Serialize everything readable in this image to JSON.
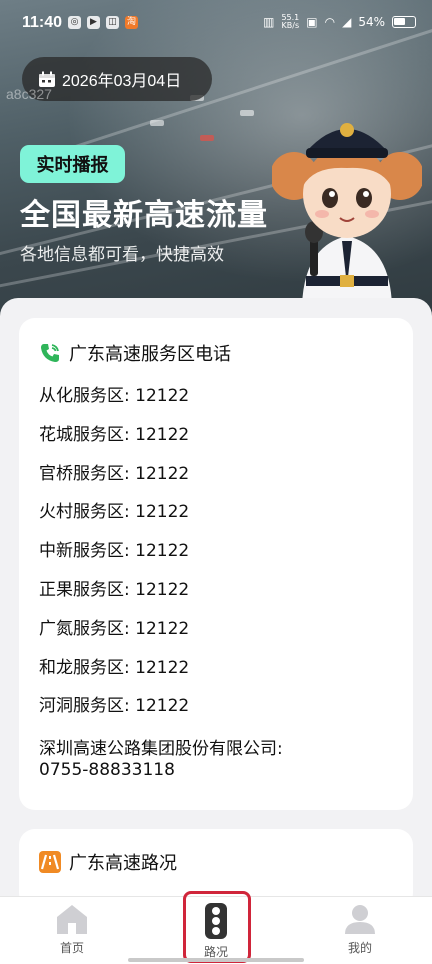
{
  "status_bar": {
    "time": "11:40",
    "net_speed_top": "55.1",
    "net_speed_bottom": "KB/s",
    "battery": "54%"
  },
  "hero": {
    "date": "2026年03月04日",
    "watermark": "a8c327",
    "badge": "实时播报",
    "title": "全国最新高速流量",
    "subtitle": "各地信息都可看，快捷高效"
  },
  "service_card": {
    "title": "广东高速服务区电话",
    "items": [
      "从化服务区: 12122",
      "花城服务区: 12122",
      "官桥服务区: 12122",
      "火村服务区: 12122",
      "中新服务区: 12122",
      "正果服务区: 12122",
      "广氮服务区: 12122",
      "和龙服务区: 12122",
      "河洞服务区: 12122"
    ],
    "company_line1": "深圳高速公路集团股份有限公司:",
    "company_line2": "0755-88833118"
  },
  "road_card": {
    "title": "广东高速路况"
  },
  "tabbar": {
    "home": "首页",
    "road": "路况",
    "mine": "我的",
    "active": "road"
  },
  "colors": {
    "badge_bg": "#7ff3d8",
    "phone_icon": "#2fb55a",
    "road_icon": "#f08a24",
    "highlight": "#d0253a"
  }
}
